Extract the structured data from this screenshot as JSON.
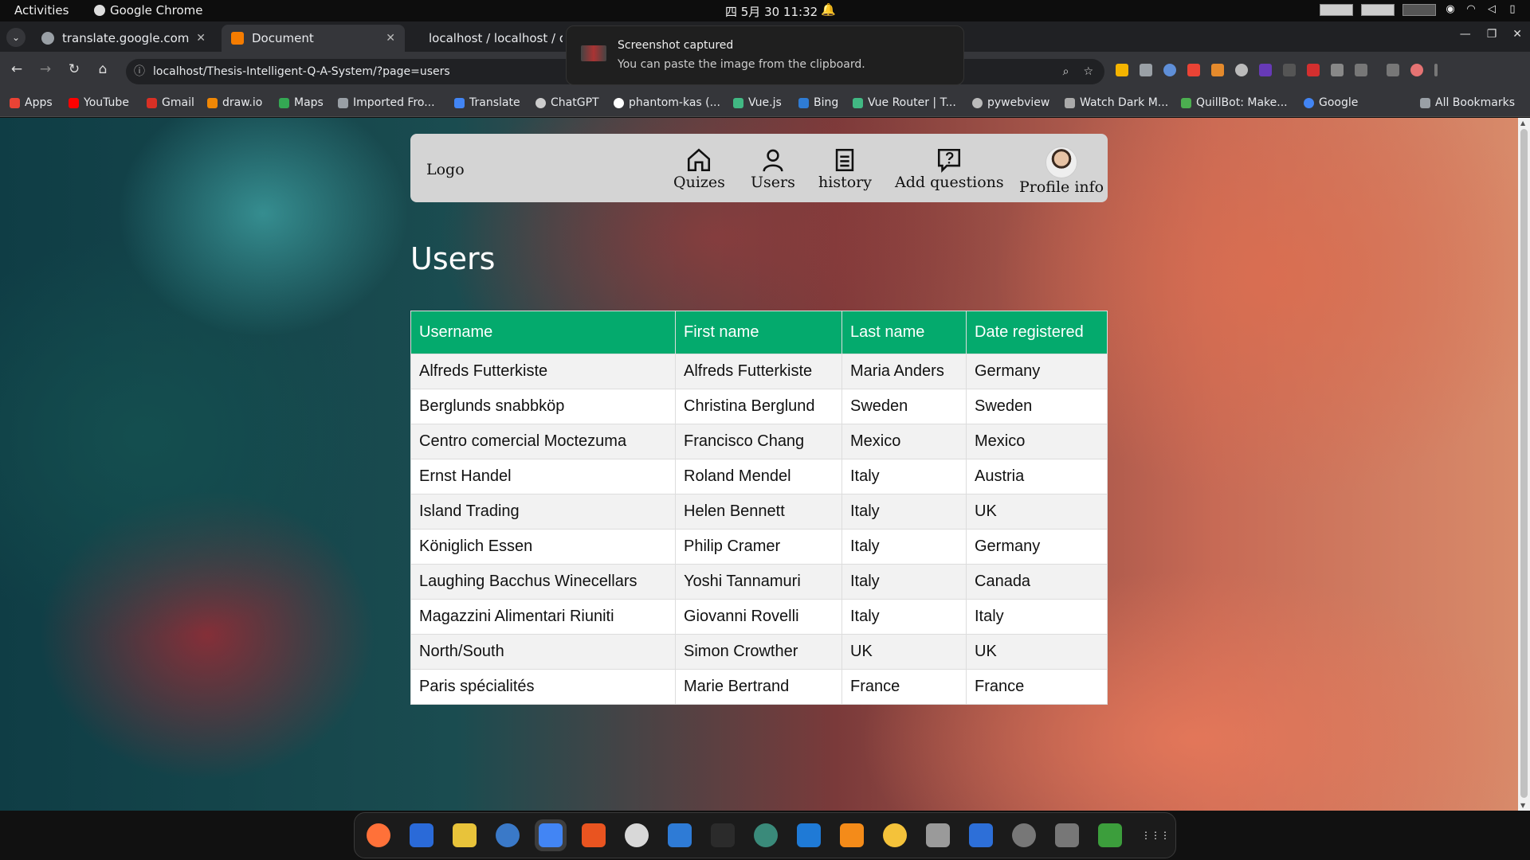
{
  "topbar": {
    "activities": "Activities",
    "app": "Google Chrome",
    "clock": "四 5月 30  11:32"
  },
  "tabs": [
    {
      "title": "translate.google.com",
      "color": "#8ab4f8"
    },
    {
      "title": "Document",
      "color": "#f57c00"
    },
    {
      "title": "localhost / localhost / q",
      "color": "#e8a33d"
    }
  ],
  "address": {
    "url": "localhost/Thesis-Intelligent-Q-A-System/?page=users"
  },
  "bookmarks": [
    {
      "label": "Apps",
      "color": "#ea4335"
    },
    {
      "label": "YouTube",
      "color": "#ff0000"
    },
    {
      "label": "Gmail",
      "color": "#d93025"
    },
    {
      "label": "draw.io",
      "color": "#f08705"
    },
    {
      "label": "Maps",
      "color": "#34a853"
    },
    {
      "label": "Imported Fro...",
      "color": "#9aa0a6"
    },
    {
      "label": "Translate",
      "color": "#4285f4"
    },
    {
      "label": "ChatGPT",
      "color": "#cccccc"
    },
    {
      "label": "phantom-kas (...",
      "color": "#ffffff"
    },
    {
      "label": "Vue.js",
      "color": "#41b883"
    },
    {
      "label": "Bing",
      "color": "#2f7cd4"
    },
    {
      "label": "Vue Router | T...",
      "color": "#41b883"
    },
    {
      "label": "pywebview",
      "color": "#bbbbbb"
    },
    {
      "label": "Watch Dark M...",
      "color": "#aaaaaa"
    },
    {
      "label": "QuillBot: Make...",
      "color": "#4caf50"
    },
    {
      "label": "Google",
      "color": "#4285f4"
    }
  ],
  "all_bookmarks": "All Bookmarks",
  "notification": {
    "title": "Screenshot captured",
    "body": "You can paste the image from the clipboard."
  },
  "nav": {
    "logo": "Logo",
    "items": [
      {
        "label": "Quizes",
        "icon": "home-icon"
      },
      {
        "label": "Users",
        "icon": "user-icon"
      },
      {
        "label": "history",
        "icon": "list-icon"
      },
      {
        "label": "Add questions",
        "icon": "question-icon"
      },
      {
        "label": "Profile info",
        "icon": "avatar"
      }
    ]
  },
  "page": {
    "title": "Users"
  },
  "table": {
    "headers": [
      "Username",
      "First name",
      "Last name",
      "Date registered"
    ],
    "header_color": "#04aa6d",
    "rows": [
      [
        "Alfreds Futterkiste",
        "Alfreds Futterkiste",
        "Maria Anders",
        "Germany"
      ],
      [
        "Berglunds snabbköp",
        "Christina Berglund",
        "Sweden",
        "Sweden"
      ],
      [
        "Centro comercial Moctezuma",
        "Francisco Chang",
        "Mexico",
        "Mexico"
      ],
      [
        "Ernst Handel",
        "Roland Mendel",
        "Italy",
        "Austria"
      ],
      [
        "Island Trading",
        "Helen Bennett",
        "Italy",
        "UK"
      ],
      [
        "Königlich Essen",
        "Philip Cramer",
        "Italy",
        "Germany"
      ],
      [
        "Laughing Bacchus Winecellars",
        "Yoshi Tannamuri",
        "Italy",
        "Canada"
      ],
      [
        "Magazzini Alimentari Riuniti",
        "Giovanni Rovelli",
        "Italy",
        "Italy"
      ],
      [
        "North/South",
        "Simon Crowther",
        "UK",
        "UK"
      ],
      [
        "Paris spécialités",
        "Marie Bertrand",
        "France",
        "France"
      ]
    ]
  },
  "dock": [
    "firefox-icon",
    "thunderbird-icon",
    "rhythmbox-icon",
    "writer-icon",
    "chrome-icon",
    "software-icon",
    "installer-icon",
    "help-icon",
    "terminal-icon",
    "settings-icon",
    "vscode-icon",
    "vlc-icon",
    "calculator-icon",
    "files-icon",
    "appcenter-icon",
    "disk-icon",
    "disk2-icon",
    "trash-icon",
    "app-grid-icon"
  ]
}
